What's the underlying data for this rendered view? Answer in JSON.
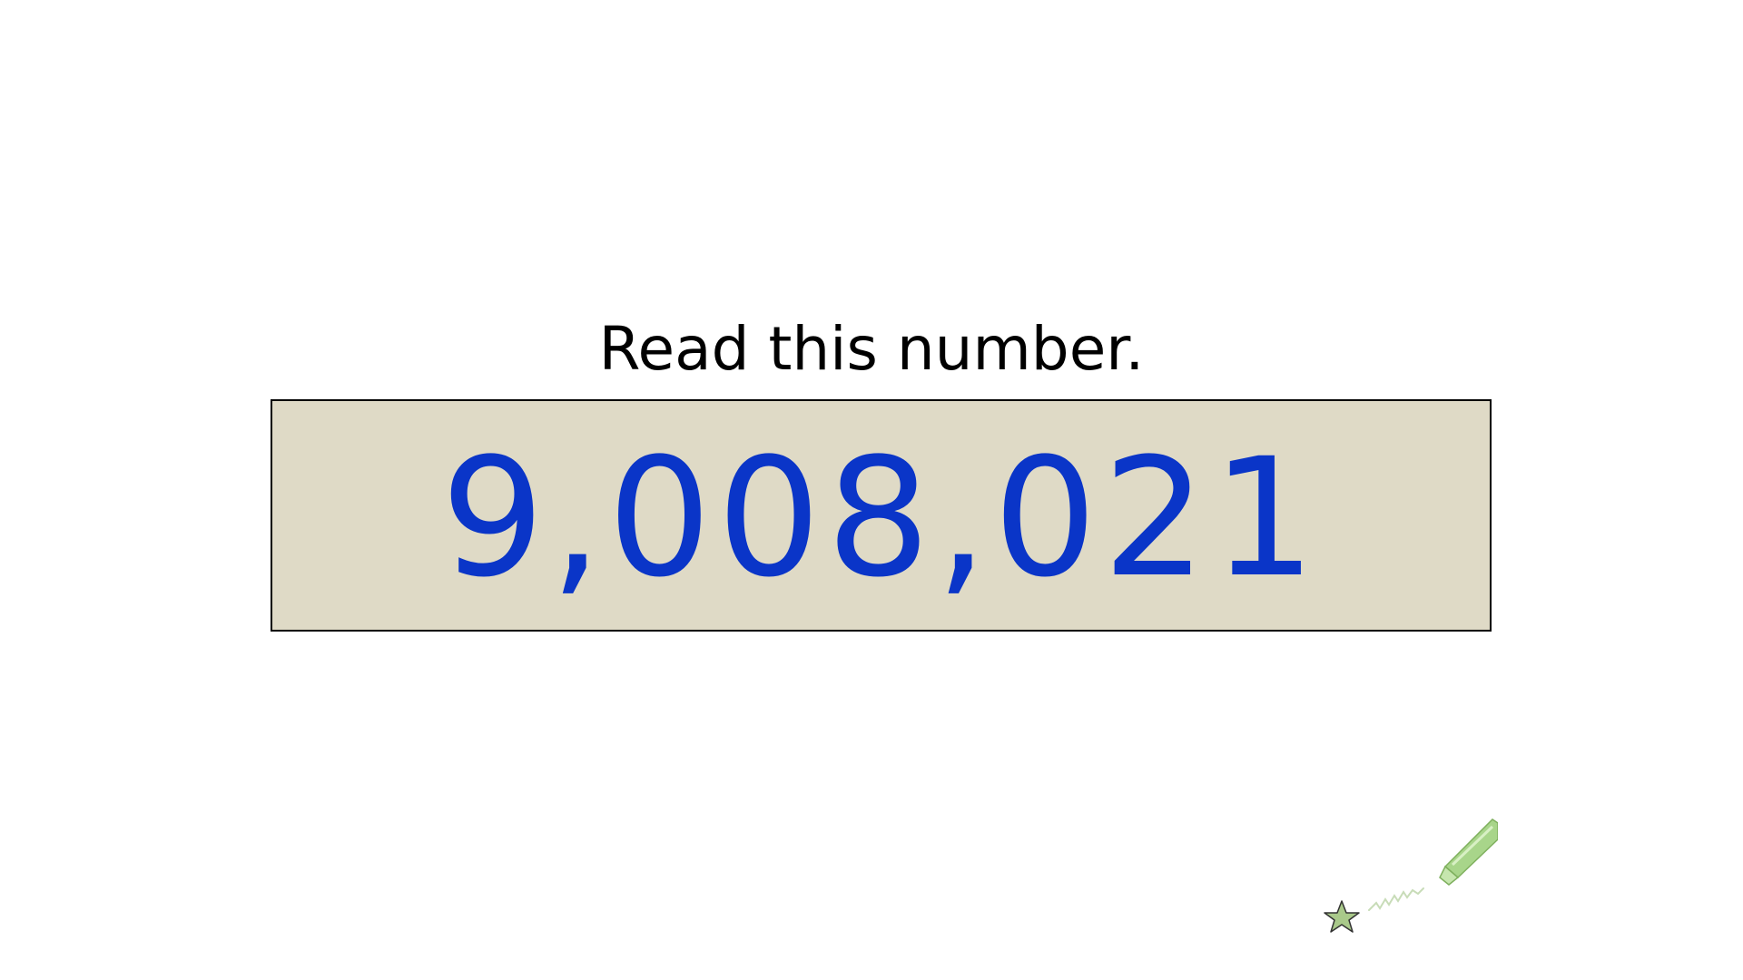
{
  "slide": {
    "prompt": "Read this number.",
    "number": "9,008,021"
  },
  "colors": {
    "background": "#ffffff",
    "box_fill": "#dfdac6",
    "box_border": "#000000",
    "number_color": "#0a35c8",
    "prompt_color": "#000000",
    "star_fill": "#a9c98a",
    "pen_color": "#9fcf7a"
  },
  "icons": {
    "star": "star-icon",
    "pen": "highlighter-pen-icon"
  }
}
